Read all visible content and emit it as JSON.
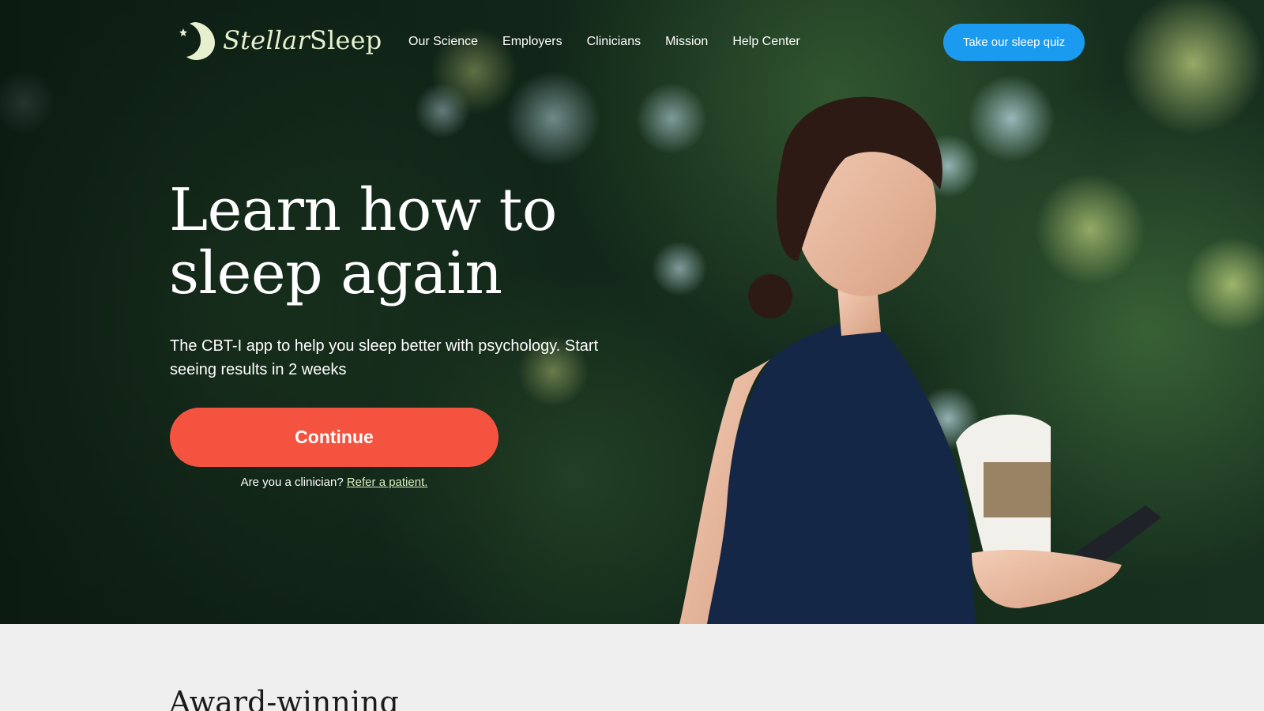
{
  "brand": {
    "name_part1": "Stellar",
    "name_part2": "Sleep",
    "logo_icon": "moon-star-icon",
    "logo_color": "#e6f0cf"
  },
  "nav": {
    "items": [
      {
        "label": "Our Science"
      },
      {
        "label": "Employers"
      },
      {
        "label": "Clinicians"
      },
      {
        "label": "Mission"
      },
      {
        "label": "Help Center"
      }
    ],
    "cta_label": "Take our sleep quiz",
    "cta_color": "#1b9bf0"
  },
  "hero": {
    "headline_line1": "Learn how to",
    "headline_line2": "sleep again",
    "subtext": "The CBT-I app to help you sleep better with psychology. Start seeing results in 2 weeks",
    "continue_label": "Continue",
    "continue_color": "#f4543f",
    "clinician_prompt": "Are you a clinician?",
    "refer_link": "Refer a patient."
  },
  "section": {
    "title": "Award-winning"
  }
}
